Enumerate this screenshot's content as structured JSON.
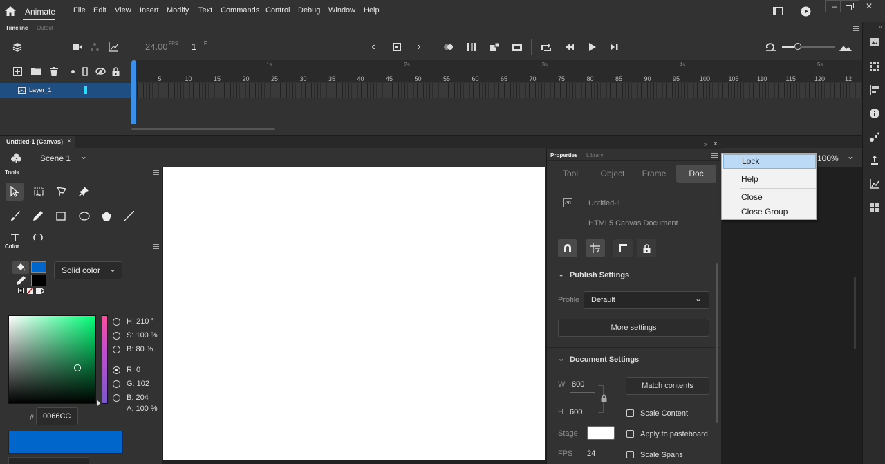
{
  "app": {
    "name": "Animate",
    "menus": [
      "File",
      "Edit",
      "View",
      "Insert",
      "Modify",
      "Text",
      "Commands",
      "Control",
      "Debug",
      "Window",
      "Help"
    ]
  },
  "timeline": {
    "tabs": [
      "Timeline",
      "Output"
    ],
    "fps_value": "24.00",
    "fps_unit": "FPS",
    "current_frame": "1",
    "frame_unit": "F",
    "frame_ticks": [
      "5",
      "10",
      "15",
      "20",
      "25",
      "30",
      "35",
      "40",
      "45",
      "50",
      "55",
      "60",
      "65",
      "70",
      "75",
      "80",
      "85",
      "90",
      "95",
      "100",
      "105",
      "110",
      "115",
      "120",
      "12"
    ],
    "second_marks": [
      "1s",
      "2s",
      "3s",
      "4s",
      "5s"
    ],
    "layers": [
      {
        "name": "Layer_1"
      }
    ]
  },
  "document": {
    "tab_label": "Untitled-1 (Canvas)",
    "scene": "Scene 1",
    "zoom": "100%"
  },
  "panels": {
    "tools_title": "Tools",
    "color_title": "Color"
  },
  "color": {
    "fill_type": "Solid color",
    "hue": "H: 210 °",
    "saturation": "S: 100 %",
    "brightness": "B: 80 %",
    "red": "R: 0",
    "green": "G: 102",
    "blue": "B: 204",
    "alpha": "A: 100 %",
    "hex_prefix": "#",
    "hex": "0066CC",
    "fill_color": "#0066cc",
    "stroke_color": "#000000"
  },
  "properties": {
    "tabs": [
      "Properties",
      "Library"
    ],
    "subtabs": [
      "Tool",
      "Object",
      "Frame",
      "Doc"
    ],
    "active_subtab": "Doc",
    "doc_icon_text": "An",
    "doc_name": "Untitled-1",
    "doc_type": "HTML5 Canvas Document",
    "publish_header": "Publish Settings",
    "profile_label": "Profile",
    "profile_value": "Default",
    "more_settings": "More settings",
    "document_header": "Document Settings",
    "w_label": "W",
    "w_value": "800",
    "h_label": "H",
    "h_value": "600",
    "match_contents": "Match contents",
    "stage_label": "Stage",
    "fps_label": "FPS",
    "fps_value": "24",
    "scale_content": "Scale Content",
    "apply_pasteboard": "Apply to pasteboard",
    "scale_spans": "Scale Spans"
  },
  "context_menu": {
    "items": [
      "Lock",
      "Help",
      "Close",
      "Close Group"
    ],
    "highlighted": "Lock"
  }
}
